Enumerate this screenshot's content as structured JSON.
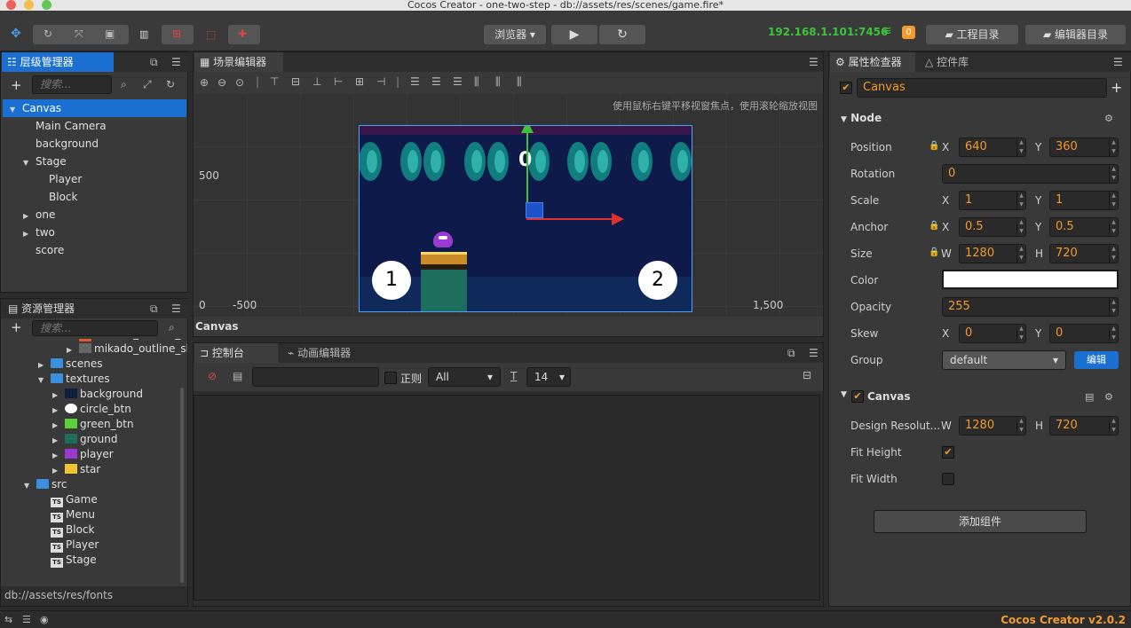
{
  "window": {
    "title": "Cocos Creator - one-two-step - db://assets/res/scenes/game.fire*"
  },
  "toolbar": {
    "browser_label": "浏览器",
    "ip": "192.168.1.101:7456",
    "wifi_count": "0",
    "project_dir": "工程目录",
    "editor_dir": "编辑器目录"
  },
  "hierarchy": {
    "tab": "层级管理器",
    "search_placeholder": "搜索...",
    "items": [
      {
        "label": "Canvas",
        "level": 0,
        "expanded": true,
        "selected": true
      },
      {
        "label": "Main Camera",
        "level": 1
      },
      {
        "label": "background",
        "level": 1
      },
      {
        "label": "Stage",
        "level": 1,
        "expanded": true
      },
      {
        "label": "Player",
        "level": 2
      },
      {
        "label": "Block",
        "level": 2
      },
      {
        "label": "one",
        "level": 1,
        "collapsed": true
      },
      {
        "label": "two",
        "level": 1,
        "collapsed": true
      },
      {
        "label": "score",
        "level": 1
      }
    ]
  },
  "assets": {
    "tab": "资源管理器",
    "search_placeholder": "搜索...",
    "items": [
      {
        "label": "mikado_outline_sha",
        "icon": "bitmap-font-icon"
      },
      {
        "label": "mikado_outline_sha",
        "icon": "image-icon"
      },
      {
        "label": "scenes",
        "icon": "folder-icon"
      },
      {
        "label": "textures",
        "icon": "folder-icon"
      },
      {
        "label": "background",
        "icon": "image-icon"
      },
      {
        "label": "circle_btn",
        "icon": "image-icon"
      },
      {
        "label": "green_btn",
        "icon": "image-icon"
      },
      {
        "label": "ground",
        "icon": "image-icon"
      },
      {
        "label": "player",
        "icon": "image-icon"
      },
      {
        "label": "star",
        "icon": "image-icon"
      },
      {
        "label": "src",
        "icon": "folder-icon"
      },
      {
        "label": "Game",
        "icon": "ts-icon"
      },
      {
        "label": "Menu",
        "icon": "ts-icon"
      },
      {
        "label": "Block",
        "icon": "ts-icon"
      },
      {
        "label": "Player",
        "icon": "ts-icon"
      },
      {
        "label": "Stage",
        "icon": "ts-icon"
      }
    ],
    "path": "db://assets/res/fonts"
  },
  "scene": {
    "tab": "场景编辑器",
    "hint": "使用鼠标右键平移视窗焦点，使用滚轮缩放视图",
    "y_label": "500",
    "x0": "0",
    "xneg": "-500",
    "x1500": "1,500",
    "origin": "0",
    "pill1": "1",
    "pill2": "2",
    "footer": "Canvas"
  },
  "console": {
    "tab_console": "控制台",
    "tab_anim": "动画编辑器",
    "regex": "正则",
    "filter": "All",
    "font_size": "14"
  },
  "inspector": {
    "tab": "属性检查器",
    "tab_lib": "控件库",
    "node_name": "Canvas",
    "section_node": "Node",
    "position": {
      "label": "Position",
      "x": "640",
      "y": "360"
    },
    "rotation": {
      "label": "Rotation",
      "value": "0"
    },
    "scale": {
      "label": "Scale",
      "x": "1",
      "y": "1"
    },
    "anchor": {
      "label": "Anchor",
      "x": "0.5",
      "y": "0.5"
    },
    "size": {
      "label": "Size",
      "w": "1280",
      "h": "720"
    },
    "color": {
      "label": "Color"
    },
    "opacity": {
      "label": "Opacity",
      "value": "255"
    },
    "skew": {
      "label": "Skew",
      "x": "0",
      "y": "0"
    },
    "group": {
      "label": "Group",
      "value": "default",
      "edit": "编辑"
    },
    "section_canvas": "Canvas",
    "design": {
      "label": "Design Resolut...",
      "w": "1280",
      "h": "720"
    },
    "fit_height": "Fit Height",
    "fit_width": "Fit Width",
    "add_component": "添加组件",
    "axis": {
      "x": "X",
      "y": "Y",
      "w": "W",
      "h": "H"
    }
  },
  "statusbar": {
    "version": "Cocos Creator v2.0.2"
  }
}
